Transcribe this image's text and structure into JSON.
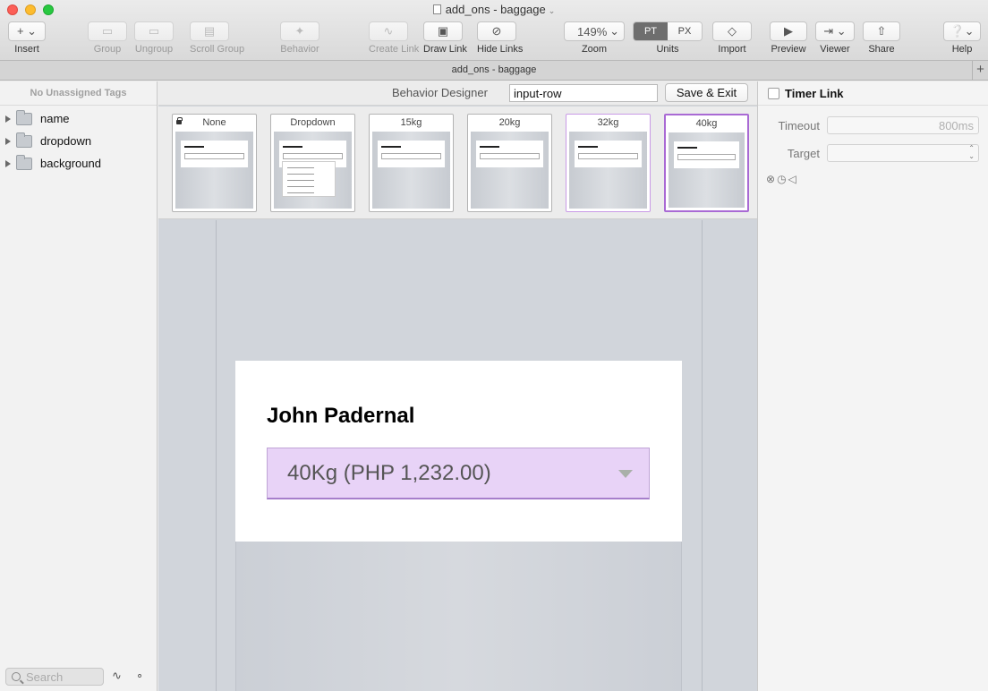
{
  "window": {
    "title": "add_ons - baggage",
    "tab_title": "add_ons - baggage"
  },
  "toolbar": {
    "insert": "Insert",
    "group": "Group",
    "ungroup": "Ungroup",
    "scroll_group": "Scroll Group",
    "behavior": "Behavior",
    "create_link": "Create Link",
    "draw_link": "Draw Link",
    "hide_links": "Hide Links",
    "zoom_value": "149%",
    "zoom": "Zoom",
    "units_pt": "PT",
    "units_px": "PX",
    "units": "Units",
    "import": "Import",
    "preview": "Preview",
    "viewer": "Viewer",
    "share": "Share",
    "help": "Help"
  },
  "sidebar": {
    "header": "No Unassigned Tags",
    "items": [
      {
        "label": "name"
      },
      {
        "label": "dropdown"
      },
      {
        "label": "background"
      }
    ],
    "search_placeholder": "Search"
  },
  "behavior_designer": {
    "label": "Behavior Designer",
    "input_value": "input-row",
    "save_exit": "Save & Exit",
    "states": [
      {
        "label": "None"
      },
      {
        "label": "Dropdown"
      },
      {
        "label": "15kg"
      },
      {
        "label": "20kg"
      },
      {
        "label": "32kg"
      },
      {
        "label": "40kg"
      }
    ]
  },
  "artboard": {
    "name": "John Padernal",
    "dropdown_value": "40Kg (PHP 1,232.00)"
  },
  "inspector": {
    "title": "Timer Link",
    "timeout_label": "Timeout",
    "timeout_value": "800ms",
    "target_label": "Target",
    "target_value": ""
  }
}
